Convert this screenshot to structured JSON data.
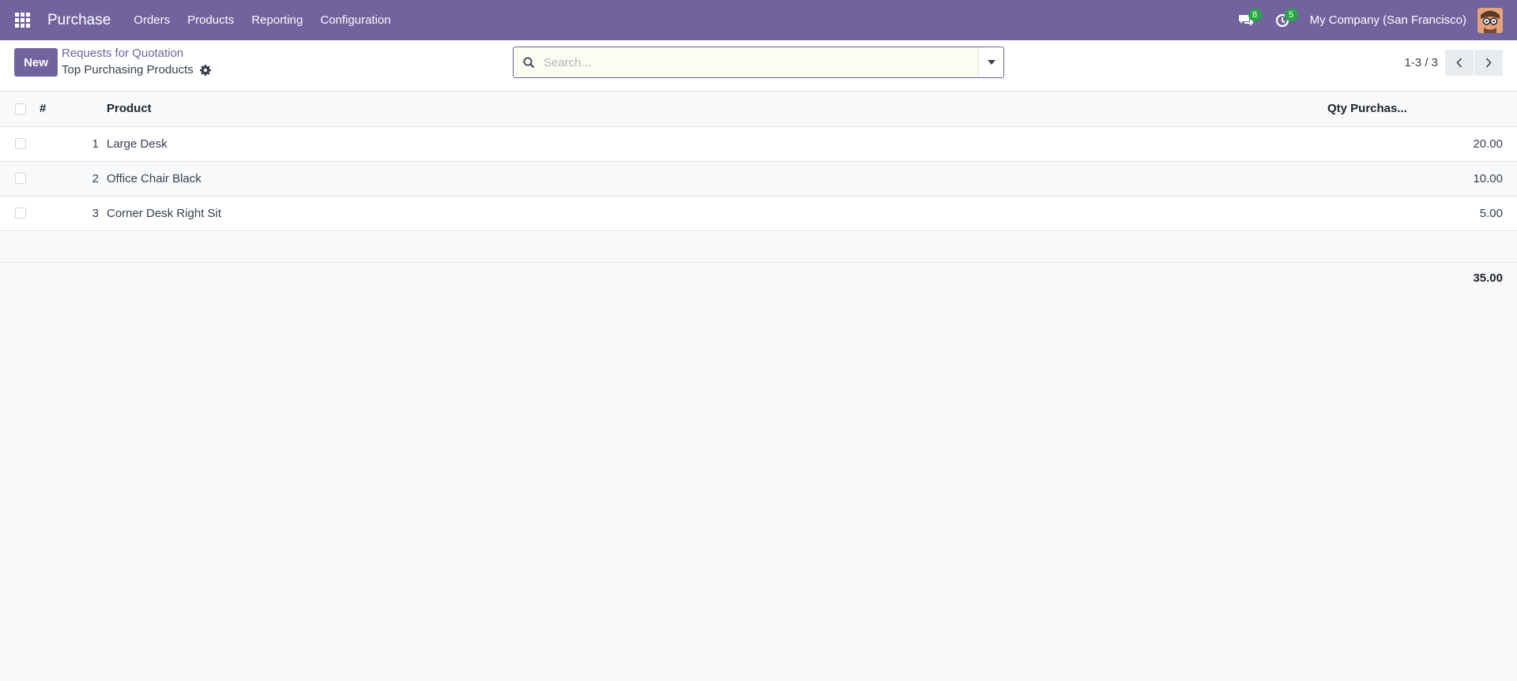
{
  "navbar": {
    "app_name": "Purchase",
    "menu": [
      "Orders",
      "Products",
      "Reporting",
      "Configuration"
    ],
    "messages_count": "8",
    "activities_count": "5",
    "company": "My Company (San Francisco)",
    "accent_color": "#71639e",
    "badge_color": "#28a745"
  },
  "control_panel": {
    "new_label": "New",
    "breadcrumb_parent": "Requests for Quotation",
    "breadcrumb_current": "Top Purchasing Products",
    "search_placeholder": "Search...",
    "pager": "1-3 / 3"
  },
  "table": {
    "columns": {
      "number": "#",
      "product": "Product",
      "qty": "Qty Purchas..."
    },
    "rows": [
      {
        "number": "1",
        "product": "Large Desk",
        "qty": "20.00"
      },
      {
        "number": "2",
        "product": "Office Chair Black",
        "qty": "10.00"
      },
      {
        "number": "3",
        "product": "Corner Desk Right Sit",
        "qty": "5.00"
      }
    ],
    "total": "35.00"
  },
  "icons": {
    "apps": "apps-grid-icon",
    "messages": "chat-icon",
    "activities": "clock-icon",
    "settings": "gear-icon",
    "search": "search-icon",
    "toggle": "caret-down-icon",
    "prev": "chevron-left-icon",
    "next": "chevron-right-icon"
  }
}
